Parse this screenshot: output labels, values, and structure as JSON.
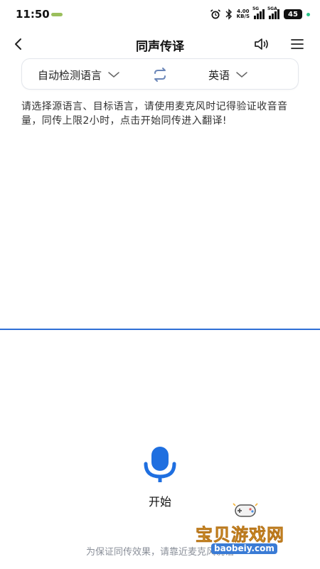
{
  "status_bar": {
    "time": "11:50",
    "net_speed_value": "4.00",
    "net_speed_unit": "KB/S",
    "signal1_label": "5G",
    "signal2_label": "5GA",
    "battery": "45"
  },
  "header": {
    "title": "同声传译"
  },
  "languages": {
    "source": "自动检测语言",
    "target": "英语"
  },
  "instruction": "请选择源语言、目标语言，请使用麦克风时记得验证收音音量，同传上限2小时，点击开始同传进入翻译!",
  "start": {
    "label": "开始"
  },
  "footer_hint": "为保证同传效果，请靠近麦克风说话",
  "watermark": {
    "text": "宝贝游戏网",
    "url": "baobeiy.com"
  },
  "colors": {
    "accent": "#2f6fd6",
    "mic": "#1f6fe0",
    "hint_text": "#8a8f99"
  }
}
